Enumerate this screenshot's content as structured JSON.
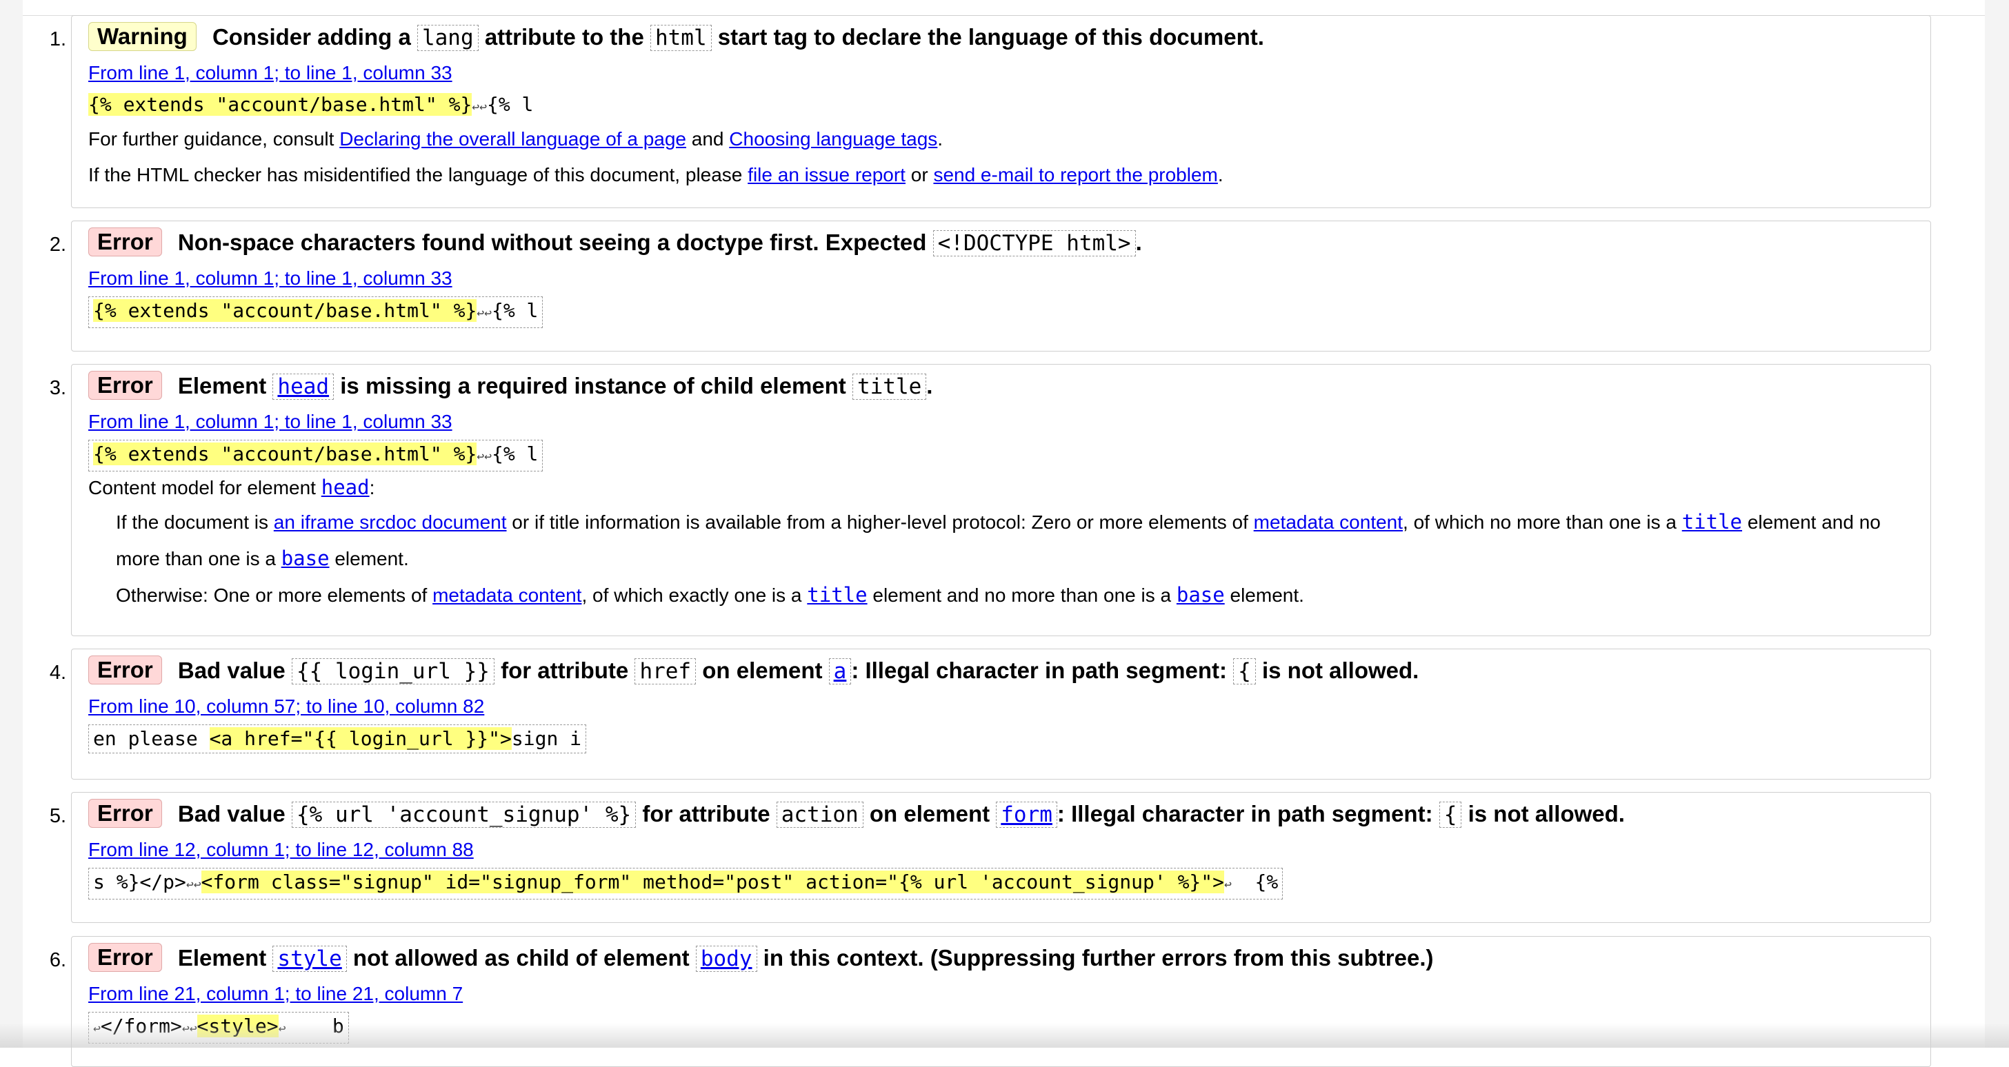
{
  "messages": [
    {
      "num": "1.",
      "type": "Warning",
      "title": {
        "p1": "Consider adding a",
        "c1": "lang",
        "p2": "attribute to the",
        "c2": "html",
        "p3": "start tag to declare the language of this document."
      },
      "location": "From line 1, column 1; to line 1, column 33",
      "extract": {
        "hl": "{% extends \"account/base.html\" %}",
        "lf": "↩↩",
        "tail": "{% l"
      },
      "guidance": {
        "prefix": "For further guidance, consult",
        "link1": "Declaring the overall language of a page",
        "mid": "and",
        "link2": "Choosing language tags",
        "end": "."
      },
      "misidentified": {
        "prefix": "If the HTML checker has misidentified the language of this document, please",
        "link1": "file an issue report",
        "mid": "or",
        "link2": "send e-mail to report the problem",
        "end": "."
      }
    },
    {
      "num": "2.",
      "type": "Error",
      "title": {
        "p1": "Non-space characters found without seeing a doctype first. Expected",
        "c1": "<!DOCTYPE html>",
        "p2": "."
      },
      "location": "From line 1, column 1; to line 1, column 33",
      "extract": {
        "hl": "{% extends \"account/base.html\" %}",
        "lf": "↩↩",
        "tail": "{% l"
      }
    },
    {
      "num": "3.",
      "type": "Error",
      "title": {
        "p1": "Element",
        "c1": "head",
        "p2": "is missing a required instance of child element",
        "c2": "title",
        "p3": "."
      },
      "location": "From line 1, column 1; to line 1, column 33",
      "extract": {
        "hl": "{% extends \"account/base.html\" %}",
        "lf": "↩↩",
        "tail": "{% l"
      },
      "content_model": {
        "label": "Content model for element",
        "element": "head",
        "colon": ":",
        "line1": {
          "p1": "If the document is",
          "link1": "an iframe srcdoc document",
          "p2": "or if title information is available from a higher-level protocol: Zero or more elements of",
          "link2": "metadata content",
          "p3": ", of which no more than one is a",
          "c1": "title",
          "p4": "element and no",
          "p5": "more than one is a",
          "c2": "base",
          "p6": "element."
        },
        "line2": {
          "p1": "Otherwise: One or more elements of",
          "link1": "metadata content",
          "p2": ", of which exactly one is a",
          "c1": "title",
          "p3": "element and no more than one is a",
          "c2": "base",
          "p4": "element."
        }
      }
    },
    {
      "num": "4.",
      "type": "Error",
      "title": {
        "p1": "Bad value",
        "c1": "{{ login_url }}",
        "p2": "for attribute",
        "c2": "href",
        "p3": "on element",
        "c3": "a",
        "p4": ": Illegal character in path segment:",
        "c4": "{",
        "p5": "is not allowed."
      },
      "location": "From line 10, column 57; to line 10, column 82",
      "extract": {
        "pre": "en please ",
        "hl": "<a href=\"{{ login_url }}\">",
        "tail": "sign i"
      }
    },
    {
      "num": "5.",
      "type": "Error",
      "title": {
        "p1": "Bad value",
        "c1": "{% url 'account_signup' %}",
        "p2": "for attribute",
        "c2": "action",
        "p3": "on element",
        "c3": "form",
        "p4": ": Illegal character in path segment:",
        "c4": "{",
        "p5": "is not allowed."
      },
      "location": "From line 12, column 1; to line 12, column 88",
      "extract": {
        "pre": "s %}</p>",
        "lf1": "↩↩",
        "hl": "<form class=\"signup\" id=\"signup_form\" method=\"post\" action=\"{% url 'account_signup' %}\">",
        "lf2": "↩",
        "tail": "  {%"
      }
    },
    {
      "num": "6.",
      "type": "Error",
      "title": {
        "p1": "Element",
        "c1": "style",
        "p2": "not allowed as child of element",
        "c2": "body",
        "p3": "in this context. (Suppressing further errors from this subtree.)"
      },
      "location": "From line 21, column 1; to line 21, column 7",
      "extract": {
        "lf1": "↩",
        "pre": "</form>",
        "lf2": "↩↩",
        "hl": "<style>",
        "lf3": "↩",
        "tail": "    b"
      }
    }
  ]
}
